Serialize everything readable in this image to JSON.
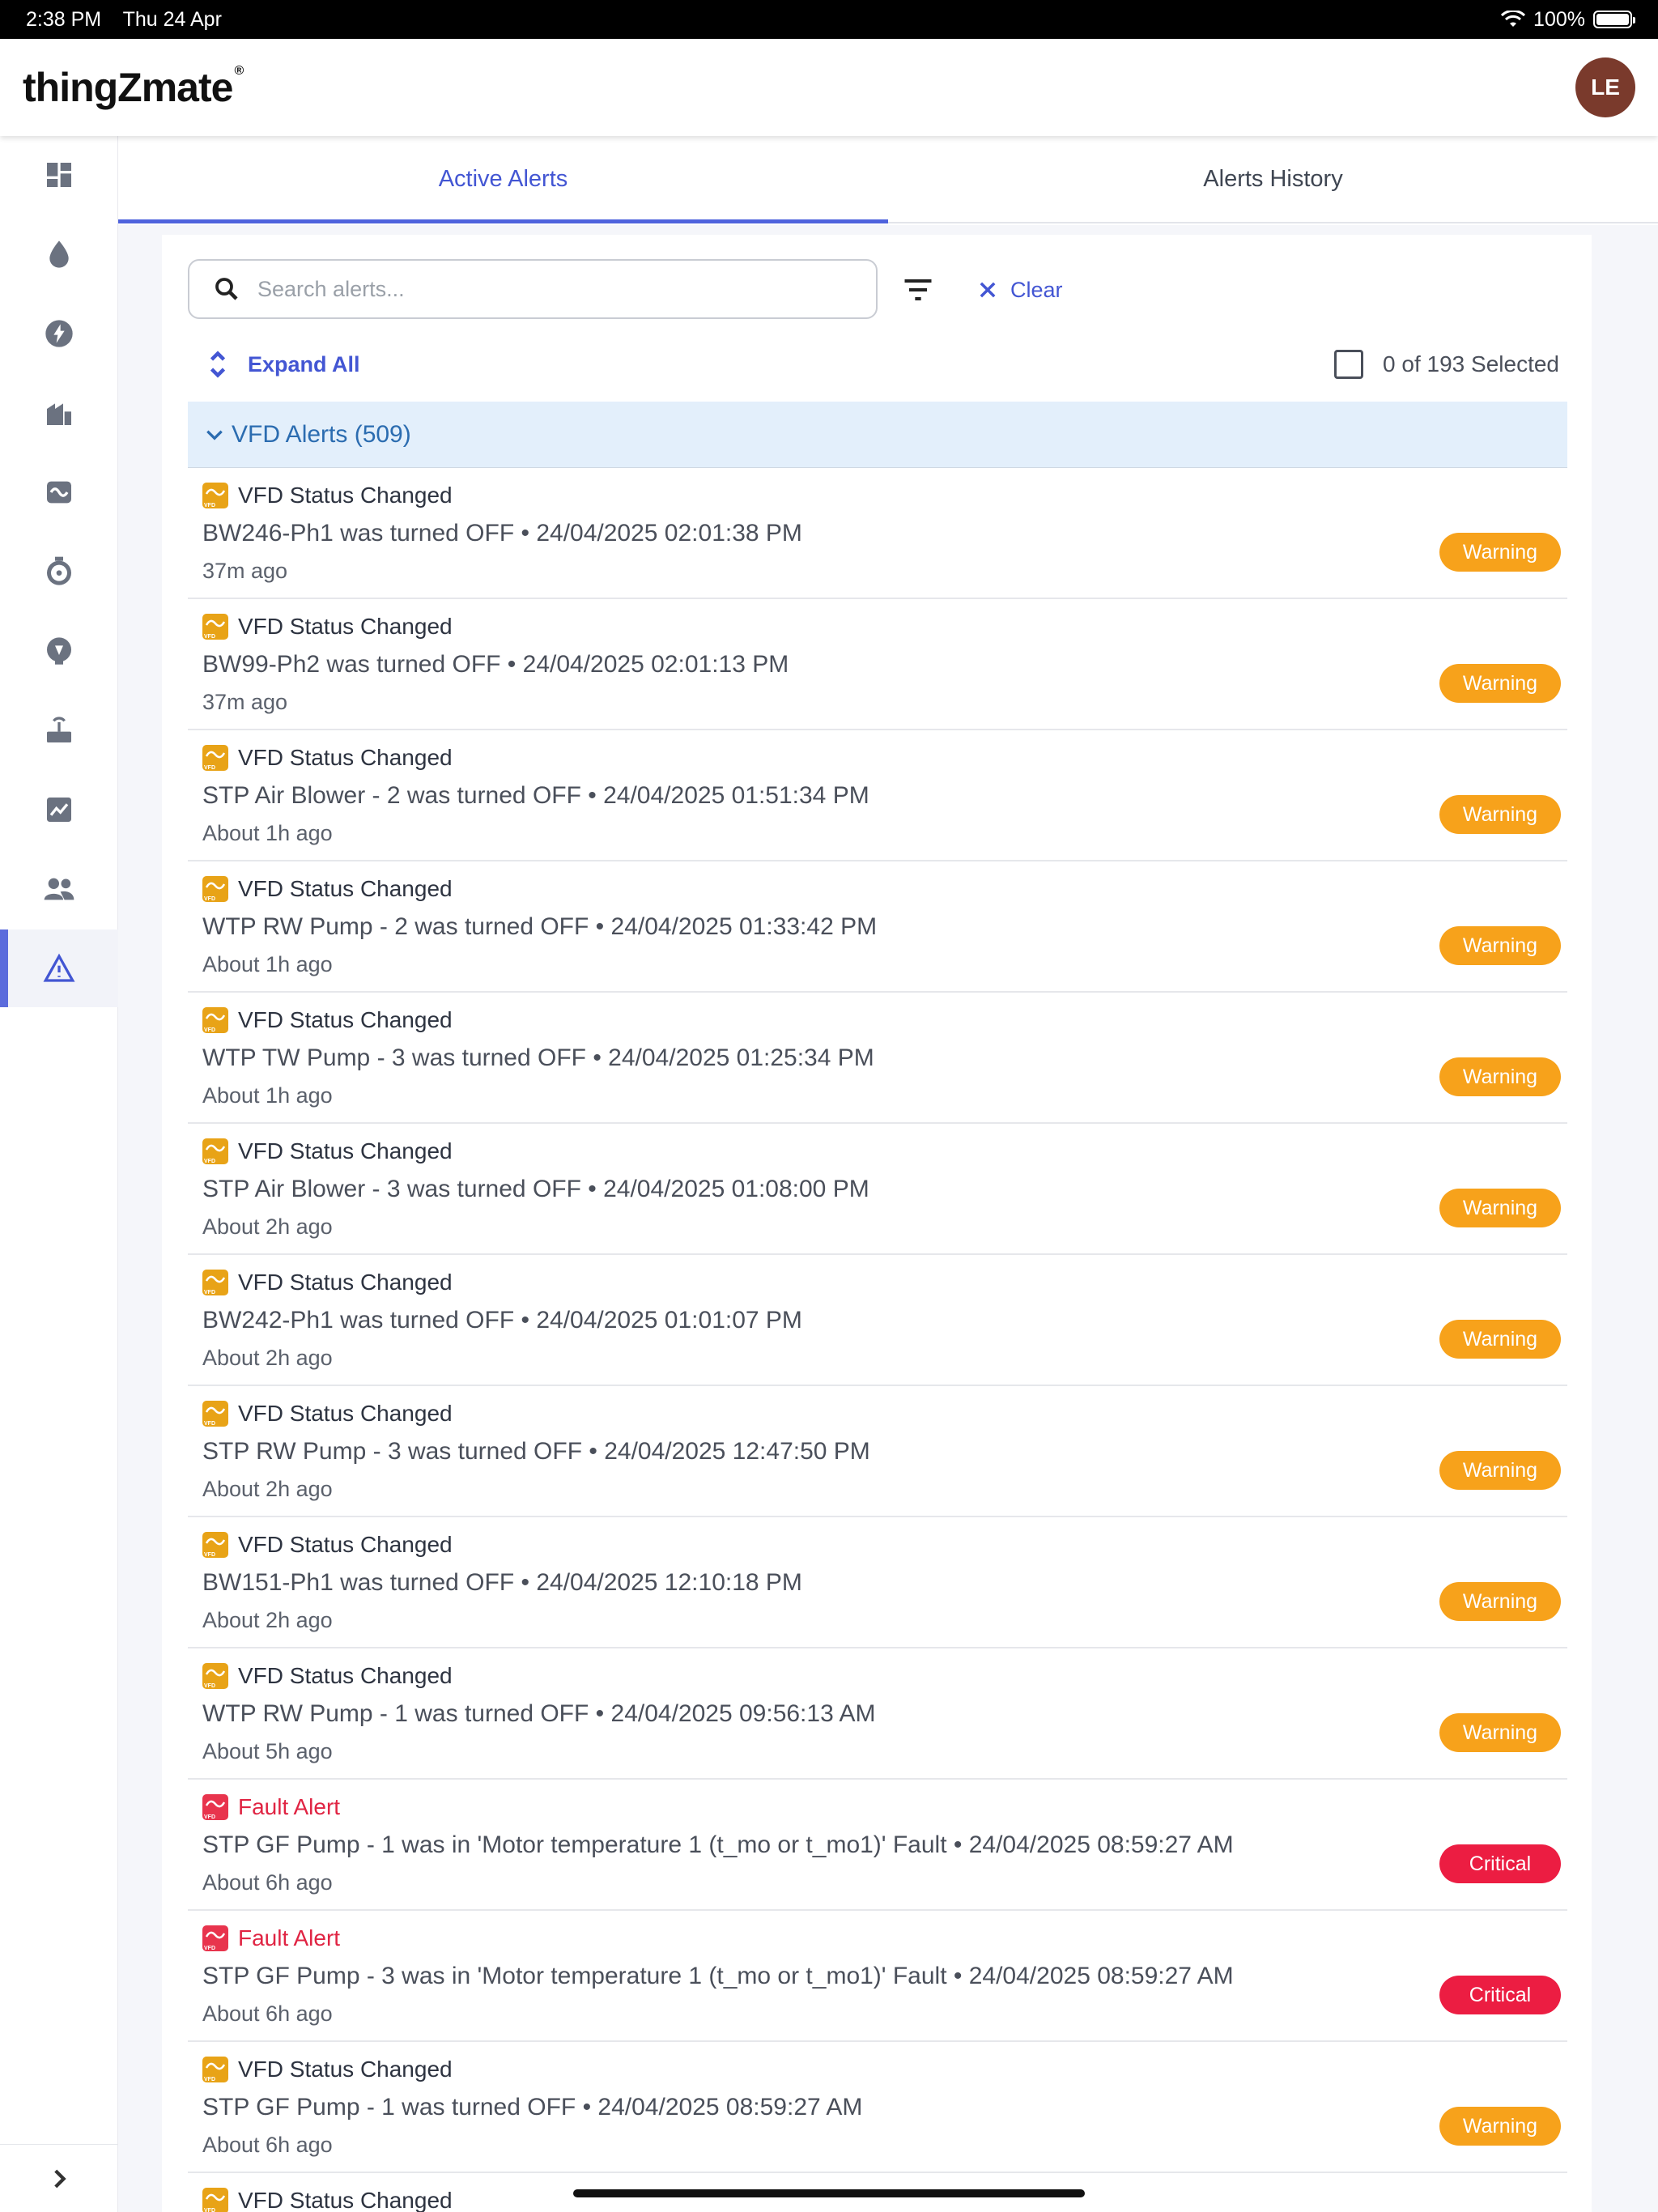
{
  "status_bar": {
    "time": "2:38 PM",
    "date": "Thu 24 Apr",
    "battery": "100%"
  },
  "header": {
    "logo": "thingZmate",
    "logo_mark": "®",
    "avatar_initials": "LE"
  },
  "tabs": [
    {
      "label": "Active Alerts",
      "active": true
    },
    {
      "label": "Alerts History",
      "active": false
    }
  ],
  "search": {
    "placeholder": "Search alerts...",
    "value": ""
  },
  "toolbar": {
    "clear_label": "Clear",
    "expand_all_label": "Expand All",
    "selected_text": "0 of 193 Selected"
  },
  "group": {
    "label": "VFD Alerts (509)"
  },
  "alerts": [
    {
      "title": "VFD Status Changed",
      "type": "status",
      "description": "BW246-Ph1 was turned OFF • 24/04/2025 02:01:38 PM",
      "ago": "37m ago",
      "severity": "Warning"
    },
    {
      "title": "VFD Status Changed",
      "type": "status",
      "description": "BW99-Ph2 was turned OFF • 24/04/2025 02:01:13 PM",
      "ago": "37m ago",
      "severity": "Warning"
    },
    {
      "title": "VFD Status Changed",
      "type": "status",
      "description": "STP Air Blower - 2 was turned OFF • 24/04/2025 01:51:34 PM",
      "ago": "About 1h ago",
      "severity": "Warning"
    },
    {
      "title": "VFD Status Changed",
      "type": "status",
      "description": "WTP RW Pump - 2 was turned OFF • 24/04/2025 01:33:42 PM",
      "ago": "About 1h ago",
      "severity": "Warning"
    },
    {
      "title": "VFD Status Changed",
      "type": "status",
      "description": "WTP TW Pump - 3 was turned OFF • 24/04/2025 01:25:34 PM",
      "ago": "About 1h ago",
      "severity": "Warning"
    },
    {
      "title": "VFD Status Changed",
      "type": "status",
      "description": "STP Air Blower - 3 was turned OFF • 24/04/2025 01:08:00 PM",
      "ago": "About 2h ago",
      "severity": "Warning"
    },
    {
      "title": "VFD Status Changed",
      "type": "status",
      "description": "BW242-Ph1 was turned OFF • 24/04/2025 01:01:07 PM",
      "ago": "About 2h ago",
      "severity": "Warning"
    },
    {
      "title": "VFD Status Changed",
      "type": "status",
      "description": "STP RW Pump - 3 was turned OFF • 24/04/2025 12:47:50 PM",
      "ago": "About 2h ago",
      "severity": "Warning"
    },
    {
      "title": "VFD Status Changed",
      "type": "status",
      "description": "BW151-Ph1 was turned OFF • 24/04/2025 12:10:18 PM",
      "ago": "About 2h ago",
      "severity": "Warning"
    },
    {
      "title": "VFD Status Changed",
      "type": "status",
      "description": "WTP RW Pump - 1 was turned OFF • 24/04/2025 09:56:13 AM",
      "ago": "About 5h ago",
      "severity": "Warning"
    },
    {
      "title": "Fault Alert",
      "type": "fault",
      "description": "STP GF Pump - 1 was in 'Motor temperature 1 (t_mo or t_mo1)' Fault • 24/04/2025 08:59:27 AM",
      "ago": "About 6h ago",
      "severity": "Critical"
    },
    {
      "title": "Fault Alert",
      "type": "fault",
      "description": "STP GF Pump - 3 was in 'Motor temperature 1 (t_mo or t_mo1)' Fault • 24/04/2025 08:59:27 AM",
      "ago": "About 6h ago",
      "severity": "Critical"
    },
    {
      "title": "VFD Status Changed",
      "type": "status",
      "description": "STP GF Pump - 1 was turned OFF • 24/04/2025 08:59:27 AM",
      "ago": "About 6h ago",
      "severity": "Warning"
    },
    {
      "title": "VFD Status Changed",
      "type": "status",
      "description": "",
      "ago": "",
      "severity": ""
    }
  ],
  "colors": {
    "accent": "#4356d3",
    "warning": "#f7a21b",
    "critical": "#ec1d42",
    "group_bg": "#e3effb"
  }
}
